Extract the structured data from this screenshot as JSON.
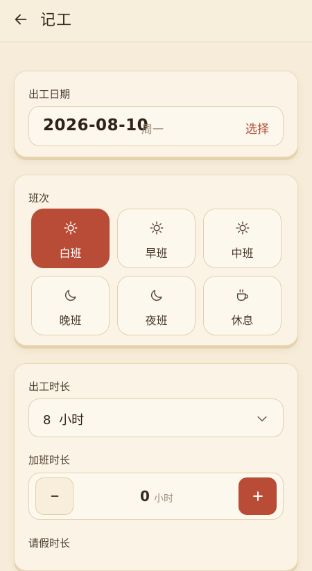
{
  "header": {
    "title": "记工",
    "back_icon": "arrow-left-icon"
  },
  "date_card": {
    "label": "出工日期",
    "date": "2026-08-10",
    "weekday": "周一",
    "select_label": "选择"
  },
  "shift_card": {
    "label": "班次",
    "selected": "白班",
    "options": [
      {
        "label": "白班",
        "icon": "sun-icon"
      },
      {
        "label": "早班",
        "icon": "sun-icon"
      },
      {
        "label": "中班",
        "icon": "sun-icon"
      },
      {
        "label": "晚班",
        "icon": "moon-icon"
      },
      {
        "label": "夜班",
        "icon": "moon-icon"
      },
      {
        "label": "休息",
        "icon": "coffee-cup-icon"
      }
    ]
  },
  "duration_card": {
    "work_hours_label": "出工时长",
    "work_hours_value": "8 小时",
    "overtime_label": "加班时长",
    "overtime_value": "0",
    "overtime_unit": "小时",
    "leave_label": "请假时长"
  },
  "colors": {
    "accent": "#b84c36",
    "background": "#f6ecd9",
    "card": "#fbf4e6",
    "text": "#3a2a1f"
  }
}
